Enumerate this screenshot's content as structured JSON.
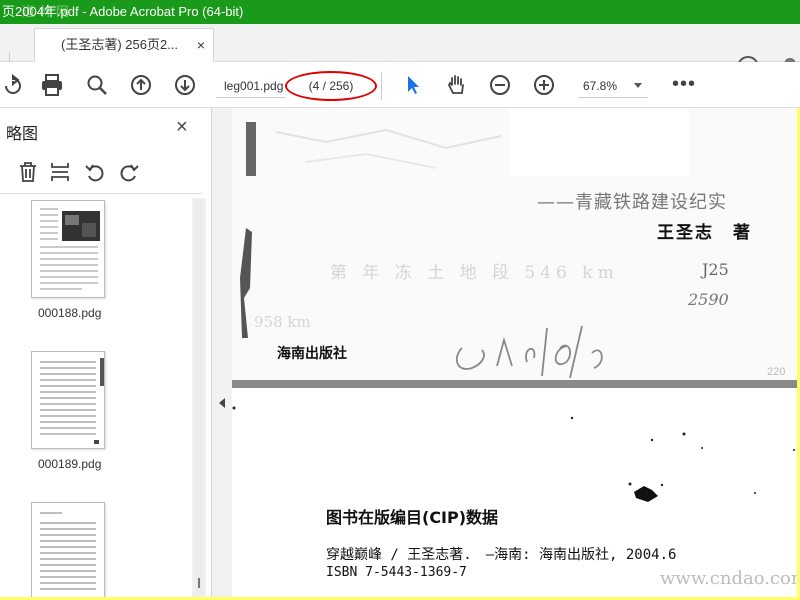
{
  "window": {
    "title": "页2004年.pdf - Adobe Acrobat Pro (64-bit)",
    "watermark": "道林网"
  },
  "tabs": [
    {
      "label": "(王圣志著) 256页2...",
      "close": "×"
    }
  ],
  "header": {
    "help_glyph": "?"
  },
  "toolbar": {
    "file_name": "leg001.pdg",
    "page_indicator": "(4 / 256)",
    "zoom": "67.8%",
    "more": "•••",
    "icons": [
      "share-icon",
      "print-icon",
      "search-zoom-icon",
      "page-up-icon",
      "page-down-icon",
      "select-cursor-icon",
      "hand-tool-icon",
      "zoom-out-icon",
      "zoom-in-icon"
    ],
    "accent_color": "#1a73e8"
  },
  "sidebar": {
    "title": "略图",
    "close": "×",
    "tools": [
      "delete-icon",
      "insert-page-icon",
      "rotate-ccw-icon",
      "rotate-cw-icon"
    ],
    "thumbnails": [
      {
        "label": "000188.pdg"
      },
      {
        "label": "000189.pdg"
      },
      {
        "label": ""
      }
    ]
  },
  "document": {
    "page1": {
      "subtitle": "——青藏铁路建设纪实",
      "author": "王圣志　著",
      "faded_line": "第 年 冻 土 地 段 546 km",
      "faded_km": "958 km",
      "publisher": "海南出版社",
      "handwriting_1": "J25",
      "handwriting_2": "2590",
      "page_number": "220"
    },
    "page2": {
      "cip_title": "图书在版编目(CIP)数据",
      "cip_line1": "穿越巅峰 / 王圣志著.　—海南: 海南出版社, 2004.6",
      "cip_line2": "ISBN 7-5443-1369-7",
      "watermark": "www.cndao.com"
    }
  },
  "colors": {
    "titlebar": "#1a9a1a",
    "frame": "#ffff66",
    "highlight_circle": "#e00000"
  }
}
